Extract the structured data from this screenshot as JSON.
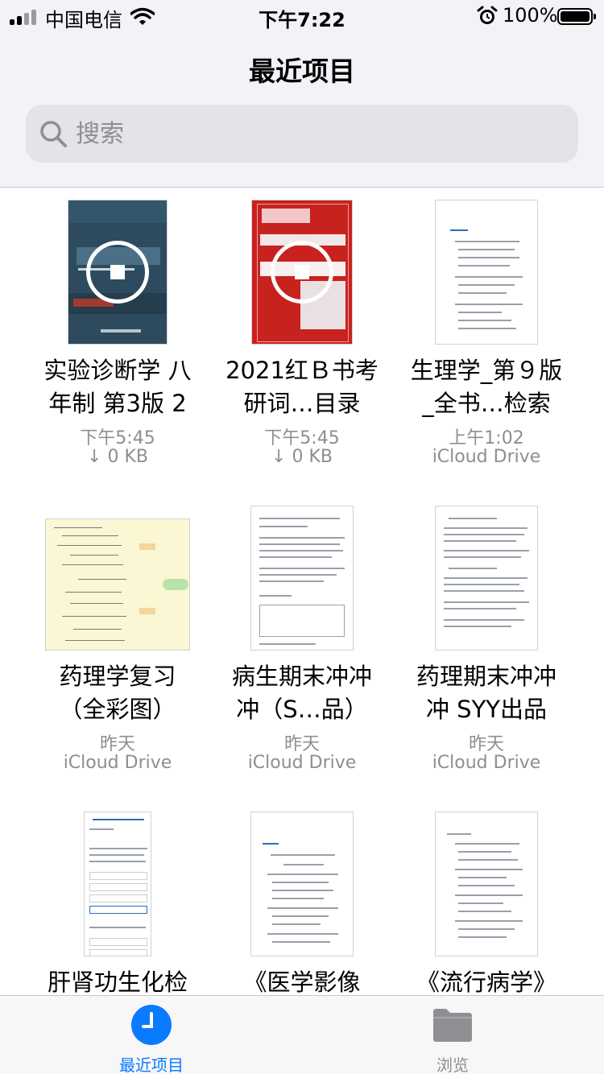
{
  "status_bar": {
    "carrier": "中国电信",
    "time": "下午7:22",
    "battery_pct": "100%"
  },
  "nav": {
    "title": "最近项目"
  },
  "search": {
    "placeholder": "搜索"
  },
  "files": [
    {
      "name_line1": "实验诊断学 八",
      "name_line2": "年制 第3版 2",
      "meta1": "下午5:45",
      "meta2": "↓ 0 KB",
      "downloading": true,
      "thumb": "cover-lab"
    },
    {
      "name_line1": "2021红Ｂ书考",
      "name_line2": "研词…目录",
      "meta1": "下午5:45",
      "meta2": "↓ 0 KB",
      "downloading": true,
      "thumb": "cover-red"
    },
    {
      "name_line1": "生理学_第９版",
      "name_line2": "_全书…检索",
      "meta1": "上午1:02",
      "meta2": "iCloud Drive",
      "downloading": false,
      "thumb": "toc"
    },
    {
      "name_line1": "药理学复习",
      "name_line2": "（全彩图）",
      "meta1": "昨天",
      "meta2": "iCloud Drive",
      "downloading": false,
      "thumb": "mindmap"
    },
    {
      "name_line1": "病生期末冲冲",
      "name_line2": "冲（S…品）",
      "meta1": "昨天",
      "meta2": "iCloud Drive",
      "downloading": false,
      "thumb": "doc"
    },
    {
      "name_line1": "药理期末冲冲",
      "name_line2": "冲 SYY出品",
      "meta1": "昨天",
      "meta2": "iCloud Drive",
      "downloading": false,
      "thumb": "doc"
    },
    {
      "name_line1": "肝肾功生化检",
      "name_line2": "",
      "meta1": "",
      "meta2": "",
      "downloading": false,
      "thumb": "quiz"
    },
    {
      "name_line1": "《医学影像",
      "name_line2": "",
      "meta1": "",
      "meta2": "",
      "downloading": false,
      "thumb": "toc"
    },
    {
      "name_line1": "《流行病学》",
      "name_line2": "",
      "meta1": "",
      "meta2": "",
      "downloading": false,
      "thumb": "toc"
    }
  ],
  "tabbar": {
    "recent_label": "最近项目",
    "browse_label": "浏览"
  },
  "colors": {
    "accent": "#0a7aff",
    "secondary_text": "#8e8e93",
    "header_bg": "#f2f2f7"
  }
}
